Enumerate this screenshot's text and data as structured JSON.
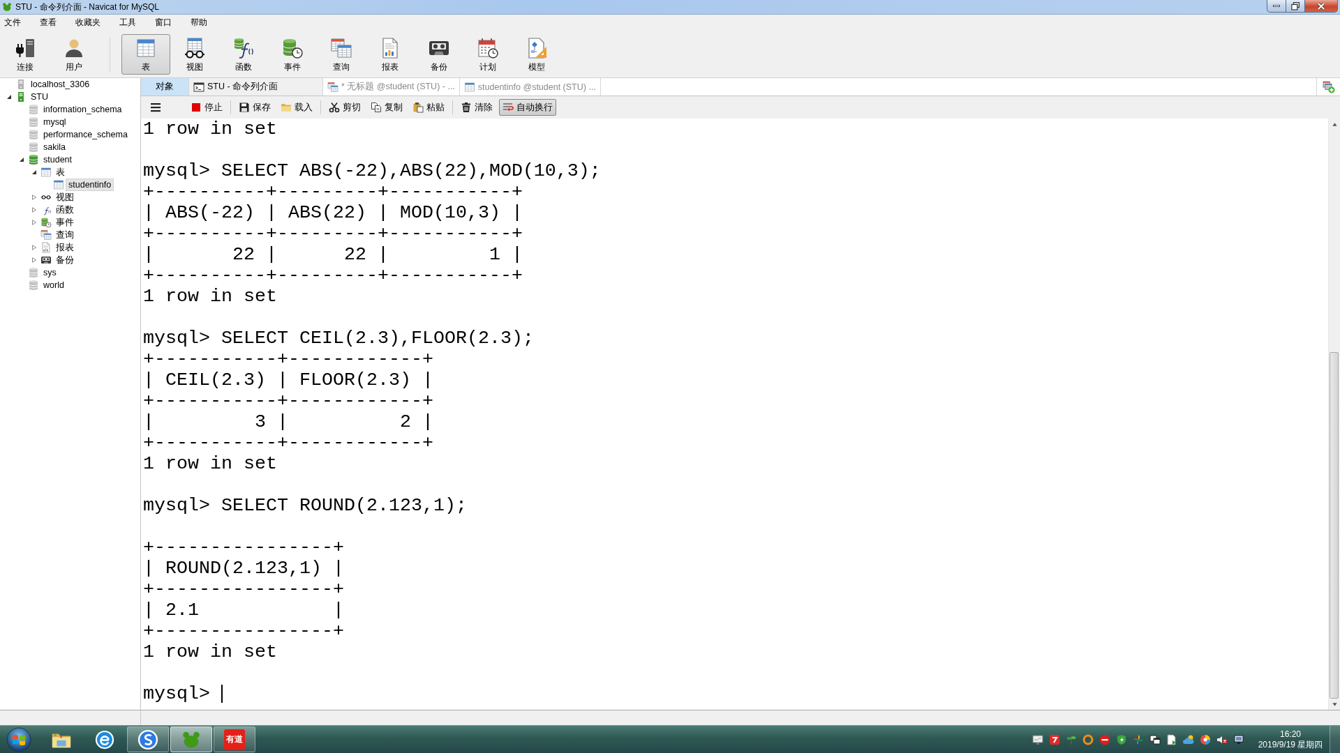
{
  "window": {
    "title": "STU - 命令列介面 - Navicat for MySQL"
  },
  "menu": [
    "文件",
    "查看",
    "收藏夹",
    "工具",
    "窗口",
    "帮助"
  ],
  "toolbar": {
    "groups": [
      [
        {
          "kind": "connection",
          "label": "连接",
          "selected": false
        },
        {
          "kind": "user",
          "label": "用户",
          "selected": false
        }
      ],
      [
        {
          "kind": "table",
          "label": "表",
          "selected": true
        },
        {
          "kind": "view",
          "label": "视图",
          "selected": false
        },
        {
          "kind": "function",
          "label": "函数",
          "selected": false
        },
        {
          "kind": "event",
          "label": "事件",
          "selected": false
        },
        {
          "kind": "query",
          "label": "查询",
          "selected": false
        },
        {
          "kind": "report",
          "label": "报表",
          "selected": false
        },
        {
          "kind": "backup",
          "label": "备份",
          "selected": false
        },
        {
          "kind": "schedule",
          "label": "计划",
          "selected": false
        },
        {
          "kind": "model",
          "label": "模型",
          "selected": false
        }
      ]
    ]
  },
  "sidebar": {
    "tree": [
      {
        "kind": "server",
        "label": "localhost_3306",
        "open": false,
        "selected": false
      },
      {
        "kind": "server",
        "label": "STU",
        "open": true,
        "expanded": true,
        "selected": false,
        "children": [
          {
            "kind": "database",
            "label": "information_schema",
            "open": false,
            "selected": false
          },
          {
            "kind": "database",
            "label": "mysql",
            "open": false,
            "selected": false
          },
          {
            "kind": "database",
            "label": "performance_schema",
            "open": false,
            "selected": false
          },
          {
            "kind": "database",
            "label": "sakila",
            "open": false,
            "selected": false
          },
          {
            "kind": "database",
            "label": "student",
            "open": true,
            "expanded": true,
            "selected": false,
            "children": [
              {
                "kind": "tables",
                "label": "表",
                "expanded": true,
                "selected": false,
                "children": [
                  {
                    "kind": "table",
                    "label": "studentinfo",
                    "selected": true
                  }
                ]
              },
              {
                "kind": "views",
                "label": "视图",
                "expanded": false,
                "selected": false
              },
              {
                "kind": "functions",
                "label": "函数",
                "expanded": false,
                "selected": false
              },
              {
                "kind": "events",
                "label": "事件",
                "expanded": false,
                "selected": false
              },
              {
                "kind": "queries",
                "label": "查询",
                "selected": false
              },
              {
                "kind": "reports",
                "label": "报表",
                "expanded": false,
                "selected": false
              },
              {
                "kind": "backups",
                "label": "备份",
                "expanded": false,
                "selected": false
              }
            ]
          },
          {
            "kind": "database",
            "label": "sys",
            "open": false,
            "selected": false
          },
          {
            "kind": "database",
            "label": "world",
            "open": false,
            "selected": false
          }
        ]
      }
    ]
  },
  "tabs": [
    {
      "kind": "objects",
      "label": "对象",
      "selected": false
    },
    {
      "kind": "console",
      "label": "STU - 命令列介面",
      "selected": true
    },
    {
      "kind": "query",
      "label": "* 无标题 @student (STU) - ...",
      "selected": false
    },
    {
      "kind": "table",
      "label": "studentinfo @student (STU) ...",
      "selected": false
    }
  ],
  "console_toolbar": {
    "groups": [
      [
        {
          "kind": "menu",
          "pressed": false
        },
        {
          "kind": "stop",
          "label": "停止",
          "pressed": false
        }
      ],
      [
        {
          "kind": "save",
          "label": "保存",
          "pressed": false
        },
        {
          "kind": "load",
          "label": "载入",
          "pressed": false
        }
      ],
      [
        {
          "kind": "cut",
          "label": "剪切",
          "pressed": false
        },
        {
          "kind": "copy",
          "label": "复制",
          "pressed": false
        },
        {
          "kind": "paste",
          "label": "粘贴",
          "pressed": false
        }
      ],
      [
        {
          "kind": "clear",
          "label": "清除",
          "pressed": false
        },
        {
          "kind": "wrap",
          "label": "自动换行",
          "pressed": true
        }
      ]
    ]
  },
  "console": {
    "blocks": [
      [
        "1 row in set"
      ],
      [
        "mysql> SELECT ABS(-22),ABS(22),MOD(10,3);",
        "+----------+---------+-----------+",
        "| ABS(-22) | ABS(22) | MOD(10,3) |",
        "+----------+---------+-----------+",
        "|       22 |      22 |         1 |",
        "+----------+---------+-----------+",
        "1 row in set"
      ],
      [
        "mysql> SELECT CEIL(2.3),FLOOR(2.3);",
        "+-----------+------------+",
        "| CEIL(2.3) | FLOOR(2.3) |",
        "+-----------+------------+",
        "|         3 |          2 |",
        "+-----------+------------+",
        "1 row in set"
      ],
      [
        "mysql> SELECT ROUND(2.123,1);"
      ],
      [
        "+----------------+",
        "| ROUND(2.123,1) |",
        "+----------------+",
        "| 2.1            |",
        "+----------------+",
        "1 row in set"
      ]
    ],
    "prompt": "mysql>"
  },
  "taskbar": {
    "apps": [
      {
        "kind": "folder",
        "running": false,
        "selected": false
      },
      {
        "kind": "e-browser",
        "running": false,
        "selected": false
      },
      {
        "kind": "s-app",
        "running": true,
        "selected": false
      },
      {
        "kind": "paw-app",
        "running": true,
        "selected": true
      },
      {
        "kind": "text-tile",
        "label": "有道",
        "running": true,
        "selected": false
      }
    ],
    "clock": {
      "time": "16:20",
      "date": "2019/9/19 星期四"
    }
  }
}
